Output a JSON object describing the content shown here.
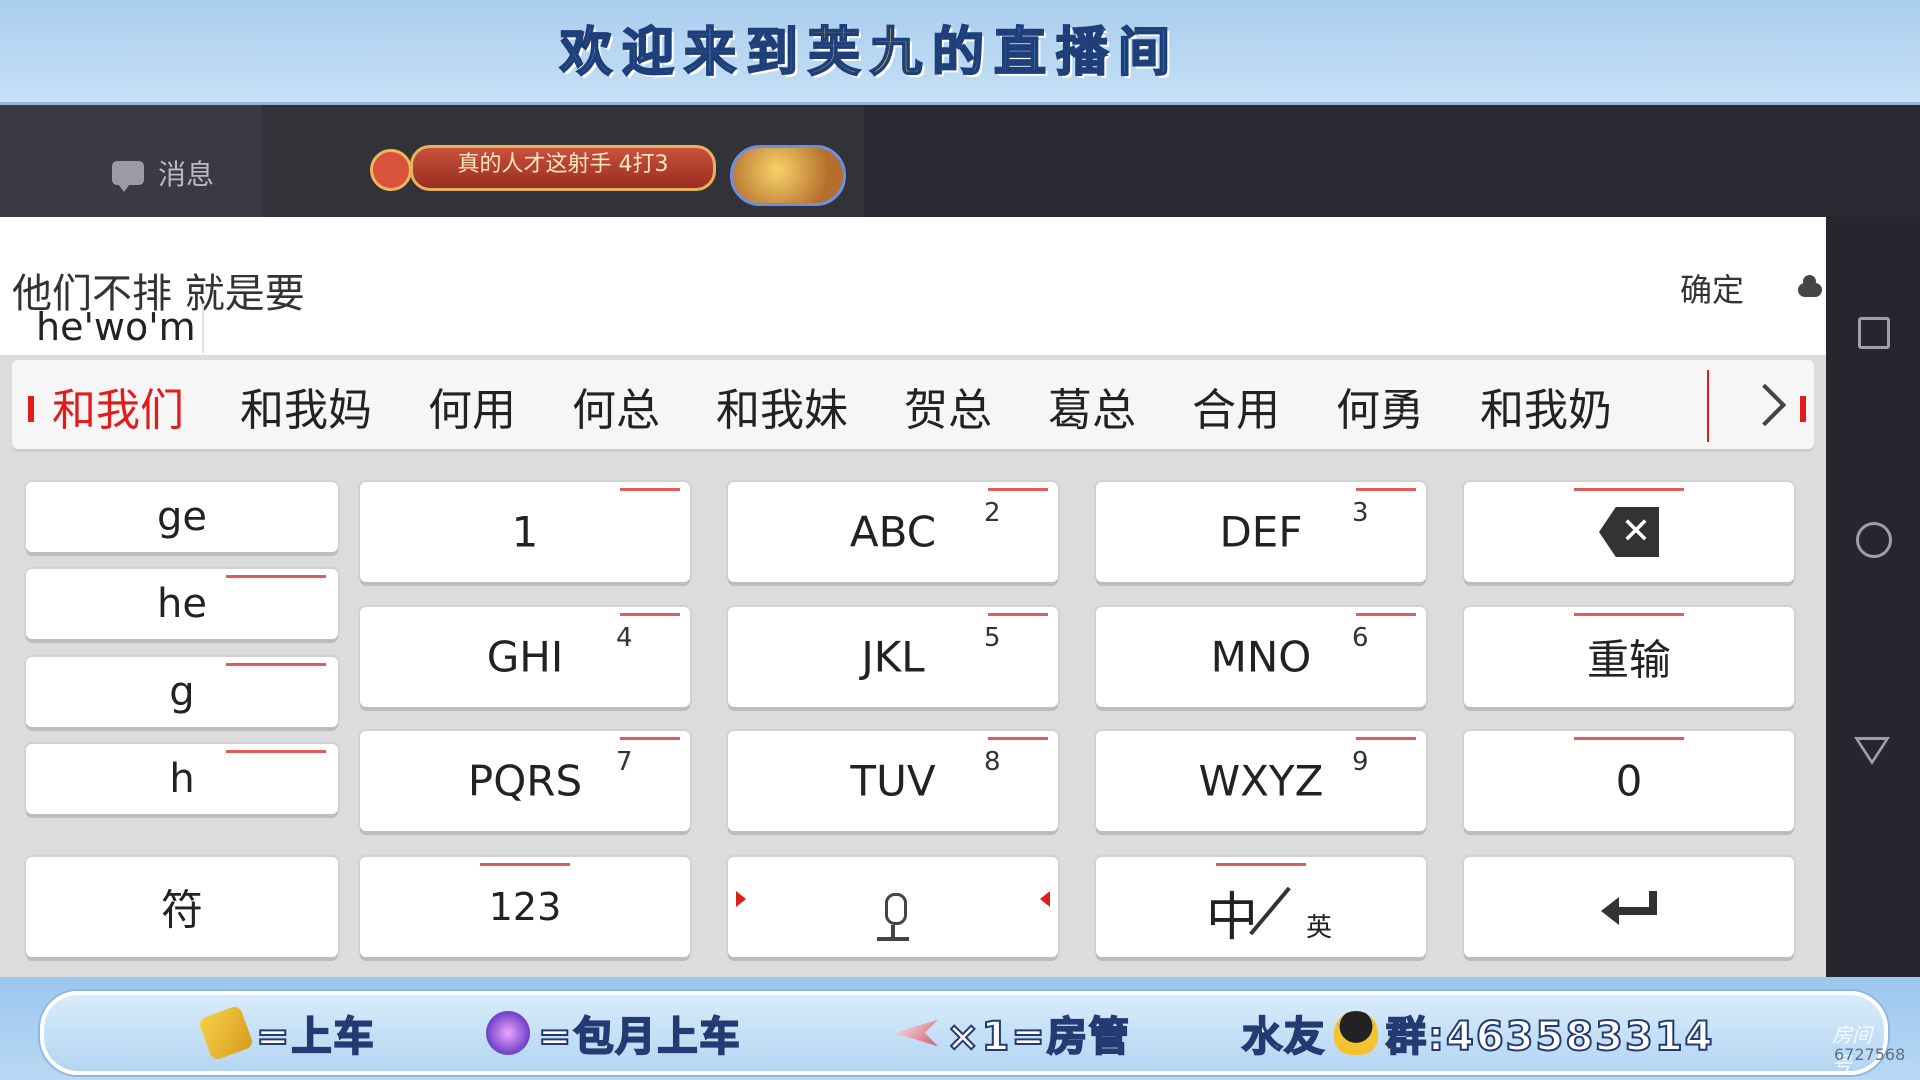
{
  "banner": {
    "title_pre": "欢迎来到",
    "title_name": "芙九",
    "title_post": "的直播间"
  },
  "stream": {
    "message_tab": "消息",
    "gift_text": "真的人才这射手 4打3"
  },
  "input": {
    "composed_text": "他们不排 就是要",
    "pinyin": "he'wo'm",
    "confirm_label": "确定"
  },
  "candidates": [
    "和我们",
    "和我妈",
    "何用",
    "何总",
    "和我妹",
    "贺总",
    "葛总",
    "合用",
    "何勇",
    "和我奶"
  ],
  "side_keys": [
    "ge",
    "he",
    "g",
    "h"
  ],
  "keys": {
    "k1": "1",
    "abc": "ABC",
    "abc_num": "2",
    "def": "DEF",
    "def_num": "3",
    "ghi": "GHI",
    "ghi_num": "4",
    "jkl": "JKL",
    "jkl_num": "5",
    "mno": "MNO",
    "mno_num": "6",
    "pqrs": "PQRS",
    "pqrs_num": "7",
    "tuv": "TUV",
    "tuv_num": "8",
    "wxyz": "WXYZ",
    "wxyz_num": "9",
    "reset": "重输",
    "zero": "0",
    "symbol": "符",
    "num123": "123",
    "lang_zh": "中",
    "lang_en": "英",
    "backspace_icon": "backspace-icon",
    "mic_icon": "microphone-icon",
    "enter_icon": "enter-icon"
  },
  "bottom": {
    "item1": "=上车",
    "item2": "=包月上车",
    "item3": "×1=房管",
    "item4_pre": "水友",
    "item4_post": "群:463583314",
    "room_label": "房间号",
    "room_id": "6727568"
  },
  "colors": {
    "accent_red": "#e21b1b",
    "banner_blue": "#a9cdee",
    "dark_bg": "#2a2a33"
  }
}
